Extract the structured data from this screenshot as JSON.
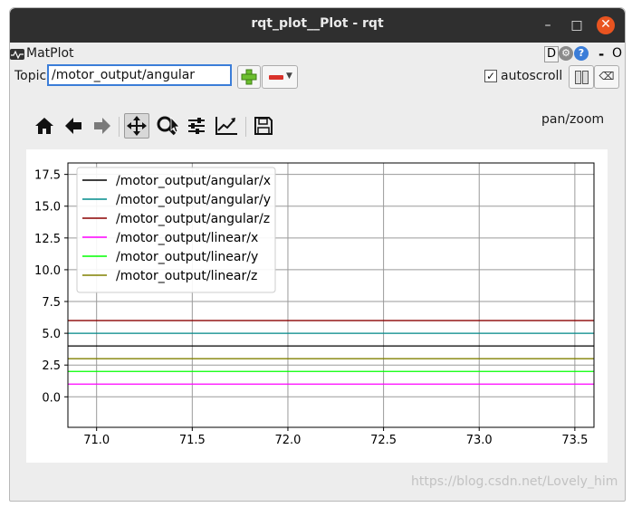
{
  "window": {
    "title": "rqt_plot__Plot - rqt",
    "minimize": "–",
    "maximize": "□",
    "close": "✕"
  },
  "dock": {
    "title": "MatPlot",
    "d_label": "D",
    "gear_icon": "gear-icon",
    "help_icon": "help-icon",
    "help_glyph": "?",
    "dash": "-",
    "o_label": "O"
  },
  "topic": {
    "label": "Topic",
    "value": "/motor_output/angular",
    "add_icon": "plus-icon",
    "remove_icon": "minus-icon"
  },
  "autoscroll": {
    "label": "autoscroll",
    "checked": true,
    "check_glyph": "✓",
    "pause_icon": "pause-icon",
    "clear_icon": "clear-icon",
    "clear_glyph": "⌫"
  },
  "toolbar": {
    "mode_label": "pan/zoom",
    "buttons": [
      "home-icon",
      "back-icon",
      "forward-icon",
      "pan-icon",
      "zoom-icon",
      "subplots-icon",
      "axes-icon",
      "save-icon"
    ]
  },
  "watermark": "https://blog.csdn.net/Lovely_him",
  "chart_data": {
    "type": "line",
    "xlim": [
      70.85,
      73.6
    ],
    "ylim": [
      -2.4,
      18.4
    ],
    "xticks": [
      "71.0",
      "71.5",
      "72.0",
      "72.5",
      "73.0",
      "73.5"
    ],
    "yticks": [
      "0.0",
      "2.5",
      "5.0",
      "7.5",
      "10.0",
      "12.5",
      "15.0",
      "17.5"
    ],
    "grid": true,
    "legend_position": "upper left",
    "series": [
      {
        "name": "/motor_output/angular/x",
        "color": "#000000",
        "x": [
          70.85,
          73.6
        ],
        "y": [
          4.0,
          4.0
        ]
      },
      {
        "name": "/motor_output/angular/y",
        "color": "#008b8b",
        "x": [
          70.85,
          73.6
        ],
        "y": [
          5.0,
          5.0
        ]
      },
      {
        "name": "/motor_output/angular/z",
        "color": "#8b0000",
        "x": [
          70.85,
          73.6
        ],
        "y": [
          6.0,
          6.0
        ]
      },
      {
        "name": "/motor_output/linear/x",
        "color": "#ff00ff",
        "x": [
          70.85,
          73.6
        ],
        "y": [
          1.0,
          1.0
        ]
      },
      {
        "name": "/motor_output/linear/y",
        "color": "#00ff00",
        "x": [
          70.85,
          73.6
        ],
        "y": [
          2.0,
          2.0
        ]
      },
      {
        "name": "/motor_output/linear/z",
        "color": "#808000",
        "x": [
          70.85,
          73.6
        ],
        "y": [
          3.0,
          3.0
        ]
      }
    ]
  }
}
